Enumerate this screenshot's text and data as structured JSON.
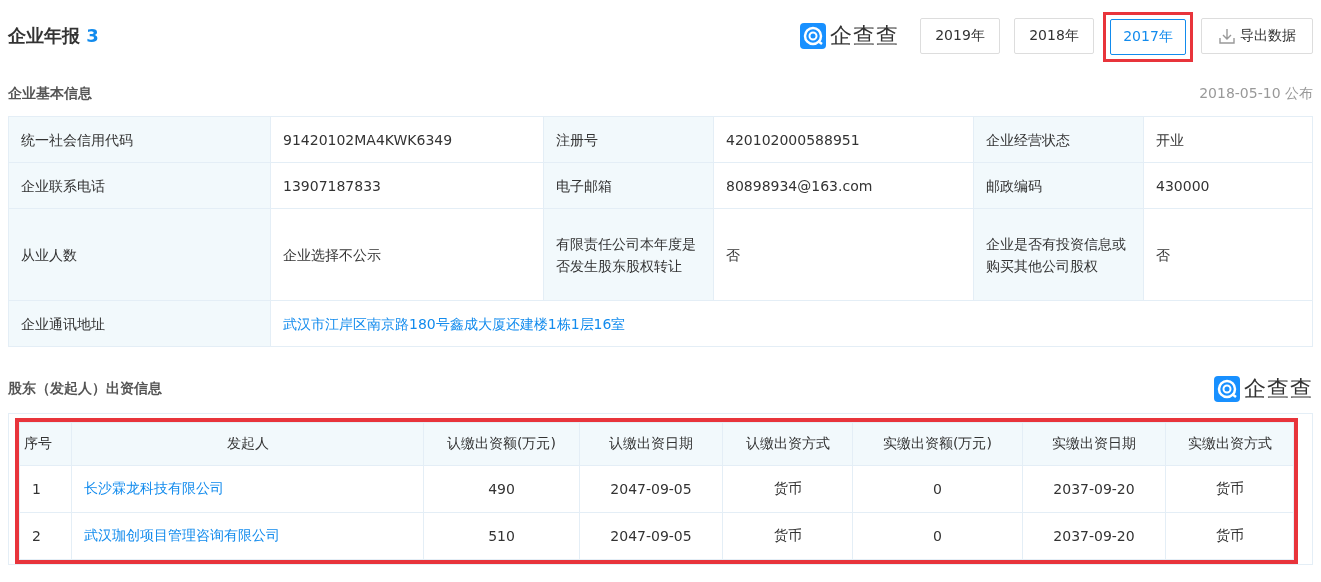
{
  "header": {
    "title": "企业年报",
    "count": "3",
    "logo": "企查查",
    "years": [
      {
        "label": "2019年",
        "selected": false,
        "highlighted": false
      },
      {
        "label": "2018年",
        "selected": false,
        "highlighted": false
      },
      {
        "label": "2017年",
        "selected": true,
        "highlighted": true
      }
    ],
    "export_button": "导出数据"
  },
  "basic_info": {
    "title": "企业基本信息",
    "published": "2018-05-10 公布",
    "rows": [
      [
        {
          "kind": "label",
          "text": "统一社会信用代码"
        },
        {
          "kind": "value",
          "text": "91420102MA4KWK6349"
        },
        {
          "kind": "label",
          "text": "注册号"
        },
        {
          "kind": "value",
          "text": "420102000588951"
        },
        {
          "kind": "label",
          "text": "企业经营状态"
        },
        {
          "kind": "value",
          "text": "开业"
        }
      ],
      [
        {
          "kind": "label",
          "text": "企业联系电话"
        },
        {
          "kind": "value",
          "text": "13907187833"
        },
        {
          "kind": "label",
          "text": "电子邮箱"
        },
        {
          "kind": "value",
          "text": "80898934@163.com"
        },
        {
          "kind": "label",
          "text": "邮政编码"
        },
        {
          "kind": "value",
          "text": "430000"
        }
      ],
      [
        {
          "kind": "label",
          "text": "从业人数"
        },
        {
          "kind": "value",
          "text": "企业选择不公示"
        },
        {
          "kind": "label",
          "text": "有限责任公司本年度是否发生股东股权转让"
        },
        {
          "kind": "value",
          "text": "否"
        },
        {
          "kind": "label",
          "text": "企业是否有投资信息或购买其他公司股权"
        },
        {
          "kind": "value",
          "text": "否"
        }
      ],
      [
        {
          "kind": "label",
          "text": "企业通讯地址"
        },
        {
          "kind": "link",
          "colspan": 5,
          "text": "武汉市江岸区南京路180号鑫成大厦还建楼1栋1层16室"
        }
      ]
    ]
  },
  "shareholders": {
    "title": "股东（发起人）出资信息",
    "logo": "企查查",
    "highlighted": true,
    "columns": [
      "序号",
      "发起人",
      "认缴出资额(万元)",
      "认缴出资日期",
      "认缴出资方式",
      "实缴出资额(万元)",
      "实缴出资日期",
      "实缴出资方式"
    ],
    "rows": [
      [
        "1",
        "长沙霖龙科技有限公司",
        "490",
        "2047-09-05",
        "货币",
        "0",
        "2037-09-20",
        "货币"
      ],
      [
        "2",
        "武汉珈创项目管理咨询有限公司",
        "510",
        "2047-09-05",
        "货币",
        "0",
        "2037-09-20",
        "货币"
      ]
    ]
  }
}
